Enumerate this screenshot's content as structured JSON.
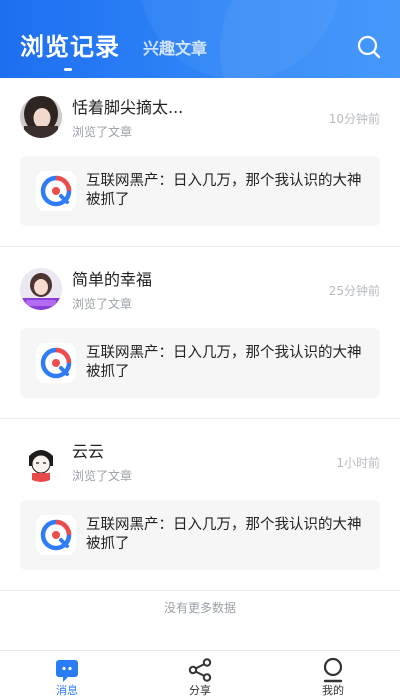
{
  "header": {
    "tabs": [
      {
        "label": "浏览记录",
        "active": true
      },
      {
        "label": "兴趣文章",
        "active": false
      }
    ],
    "search_icon": "search-icon"
  },
  "entries": [
    {
      "username": "恬着脚尖摘太...",
      "action": "浏览了文章",
      "time": "10分钟前",
      "article_title": "互联网黑产：日入几万，那个我认识的大神被抓了"
    },
    {
      "username": "简单的幸福",
      "action": "浏览了文章",
      "time": "25分钟前",
      "article_title": "互联网黑产：日入几万，那个我认识的大神被抓了"
    },
    {
      "username": "云云",
      "action": "浏览了文章",
      "time": "1小时前",
      "article_title": "互联网黑产：日入几万，那个我认识的大神被抓了"
    }
  ],
  "footer_text": "没有更多数据",
  "bottom_nav": [
    {
      "label": "消息",
      "icon": "message-icon",
      "active": true
    },
    {
      "label": "分享",
      "icon": "share-icon",
      "active": false
    },
    {
      "label": "我的",
      "icon": "profile-icon",
      "active": false
    }
  ],
  "colors": {
    "primary": "#1e6ef0",
    "nav_active": "#2a7cf4",
    "text": "#222222",
    "muted": "#9aa0a8"
  }
}
